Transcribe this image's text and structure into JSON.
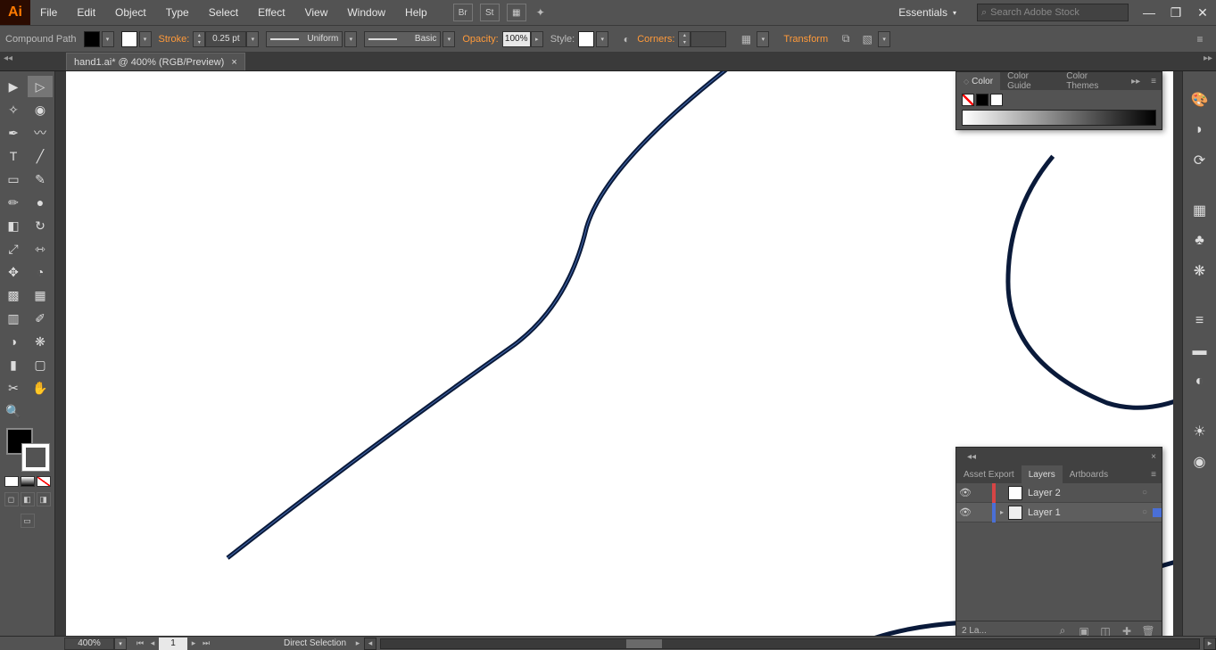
{
  "menubar": {
    "items": [
      "File",
      "Edit",
      "Object",
      "Type",
      "Select",
      "Effect",
      "View",
      "Window",
      "Help"
    ],
    "icon_labels": [
      "Br",
      "St"
    ],
    "workspace": "Essentials",
    "search_placeholder": "Search Adobe Stock"
  },
  "controlbar": {
    "selection_type": "Compound Path",
    "stroke_label": "Stroke:",
    "stroke_weight": "0.25 pt",
    "profile_uniform": "Uniform",
    "profile_basic": "Basic",
    "opacity_label": "Opacity:",
    "opacity_value": "100%",
    "style_label": "Style:",
    "corners_label": "Corners:",
    "transform_label": "Transform"
  },
  "doc_tab": {
    "title": "hand1.ai* @ 400% (RGB/Preview)"
  },
  "panels": {
    "color": {
      "tabs": [
        "Color",
        "Color Guide",
        "Color Themes"
      ],
      "active": 0
    },
    "layers": {
      "tabs": [
        "Asset Export",
        "Layers",
        "Artboards"
      ],
      "active": 1,
      "layers": [
        {
          "name": "Layer 2",
          "barcolor": "#d64545",
          "selected": false,
          "expandable": false
        },
        {
          "name": "Layer 1",
          "barcolor": "#4a6fd6",
          "selected": true,
          "expandable": true
        }
      ],
      "footer_text": "2 La..."
    }
  },
  "statusbar": {
    "zoom": "400%",
    "artboard_index": "1",
    "tool_name": "Direct Selection"
  },
  "colors": {
    "accent": "#ff9a3a",
    "panel_bg": "#535353",
    "app_bg": "#3a3a3a"
  }
}
